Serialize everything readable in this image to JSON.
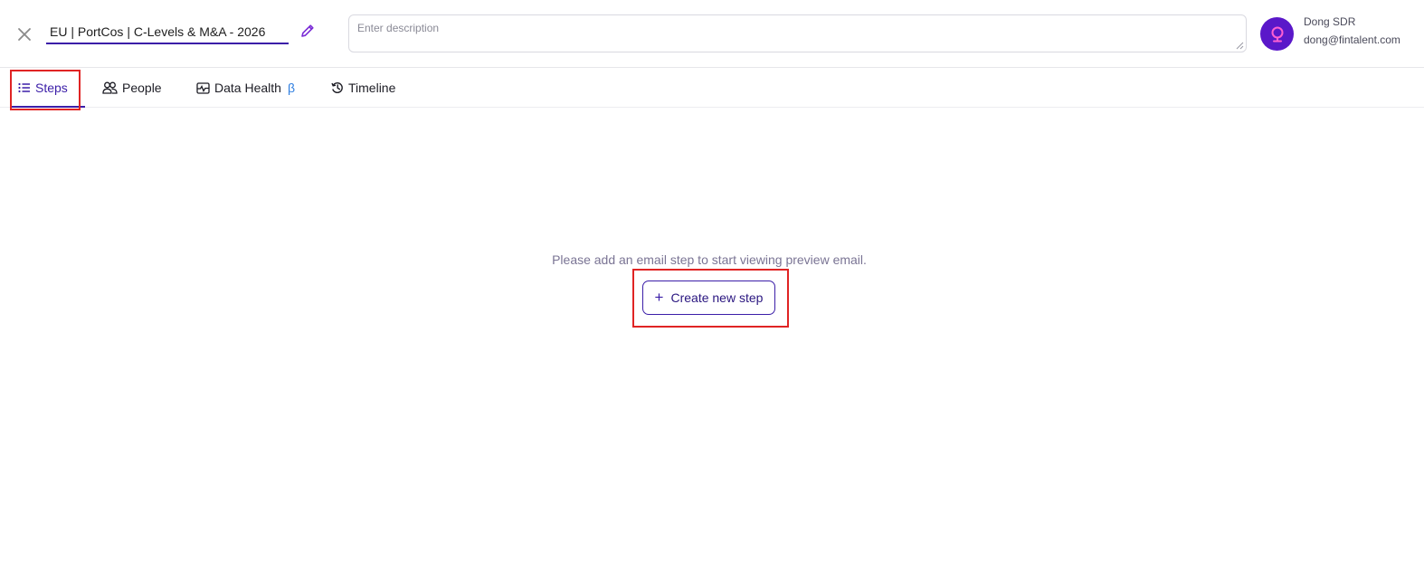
{
  "header": {
    "title_value": "EU | PortCos | C-Levels & M&A - 2026",
    "description_placeholder": "Enter description",
    "icons": {
      "close": "close-icon",
      "edit": "pencil-icon",
      "avatar": "location-pin-icon"
    },
    "user": {
      "name": "Dong SDR",
      "email": "dong@fintalent.com"
    }
  },
  "tabs": [
    {
      "label": "Steps",
      "icon": "list-icon",
      "active": true
    },
    {
      "label": "People",
      "icon": "people-icon",
      "active": false
    },
    {
      "label": "Data Health",
      "icon": "data-health-icon",
      "badge": "β",
      "active": false
    },
    {
      "label": "Timeline",
      "icon": "history-icon",
      "active": false
    }
  ],
  "main": {
    "empty_message": "Please add an email step to start viewing preview email.",
    "create_button_label": "Create new step",
    "create_button_icon": "plus-icon"
  },
  "colors": {
    "accent": "#3b1ea8",
    "avatar": "#5a18c9",
    "avatar_icon": "#ff5fd2",
    "beta": "#2f7ee0",
    "highlight": "#e02424",
    "muted_text": "#7a7494"
  }
}
